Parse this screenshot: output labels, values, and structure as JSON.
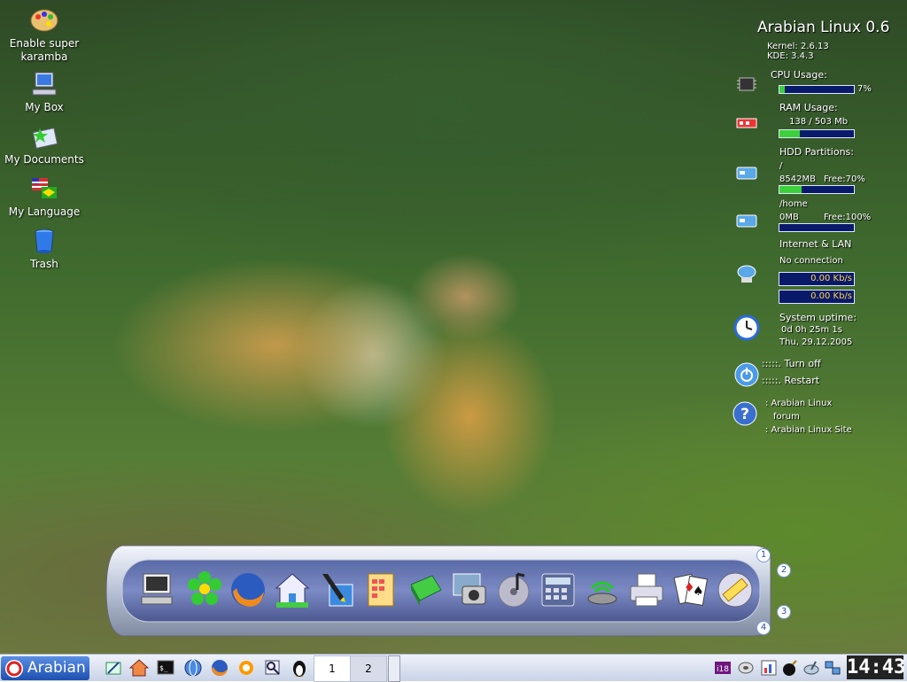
{
  "desktop_icons": [
    {
      "label": "Enable super karamba",
      "icon": "paint-palette-icon"
    },
    {
      "label": "My Box",
      "icon": "computer-icon"
    },
    {
      "label": "My Documents",
      "icon": "documents-icon"
    },
    {
      "label": "My Language",
      "icon": "language-flag-icon"
    },
    {
      "label": "Trash",
      "icon": "trash-icon"
    }
  ],
  "karamba": {
    "title": "Arabian Linux 0.6",
    "kernel": "Kernel: 2.6.13",
    "kde": "KDE: 3.4.3",
    "cpu_label": "CPU Usage:",
    "cpu_value": "7%",
    "cpu_percent": 7,
    "ram_label": "RAM Usage:",
    "ram_value": "138 / 503 Mb",
    "ram_percent": 27,
    "hdd_label": "HDD Partitions:",
    "root_label": "/",
    "root_size": "8542MB",
    "root_free": "Free:70%",
    "root_used_percent": 30,
    "home_label": "/home",
    "home_size": "0MB",
    "home_free": "Free:100%",
    "home_used_percent": 0,
    "net_label": "Internet & LAN",
    "net_status": "No connection",
    "net_down": "0.00 Kb/s",
    "net_up": "0.00 Kb/s",
    "uptime_label": "System uptime:",
    "uptime_value": "0d 0h 25m 1s",
    "date_value": "Thu, 29.12.2005",
    "turn_off": ":::::. Turn off",
    "restart": ":::::. Restart",
    "forum_line1": ": Arabian Linux",
    "forum_line2": "forum",
    "site": ": Arabian Linux Site"
  },
  "dock": {
    "bubbles": [
      "1",
      "2",
      "3",
      "4"
    ],
    "icons": [
      "computer-icon",
      "icq-flower-icon",
      "firefox-icon",
      "home-icon",
      "pen-editor-icon",
      "calculator-notes-icon",
      "book-icon",
      "photo-camera-icon",
      "music-cd-icon",
      "calculator-icon",
      "network-icon",
      "printer-icon",
      "cards-game-icon",
      "film-icon"
    ]
  },
  "taskbar": {
    "start_label": "Arabian",
    "quick_launch": [
      "edit-icon",
      "home-icon",
      "terminal-icon",
      "network-globe-icon",
      "firefox-icon",
      "tools-icon",
      "search-icon",
      "tux-icon"
    ],
    "pager": [
      "1",
      "2"
    ],
    "tray": [
      "i18n-icon",
      "mouse-icon",
      "chart-icon",
      "bomb-icon",
      "satellite-icon",
      "network-status-icon"
    ],
    "clock": "14:43"
  }
}
